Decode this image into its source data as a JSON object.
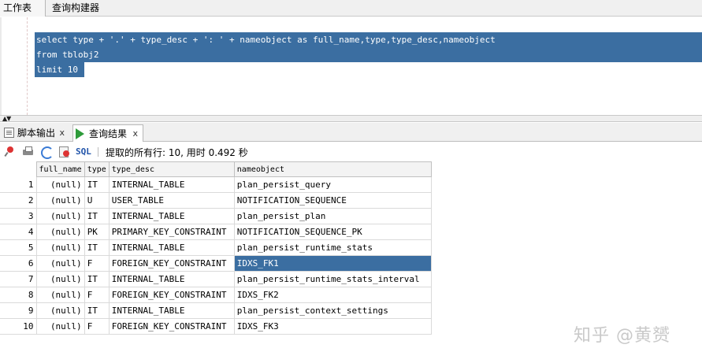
{
  "top_tabs": [
    "工作表",
    "查询构建器"
  ],
  "editor": {
    "lines": [
      "select type + '.' + type_desc + ': ' + nameobject as full_name,type,type_desc,nameobject",
      "from tblobj2",
      "limit 10"
    ]
  },
  "output_tabs": [
    {
      "label": "脚本输出",
      "close": "x"
    },
    {
      "label": "查询结果",
      "close": "x"
    }
  ],
  "toolbar": {
    "icons": [
      "pin-icon",
      "print-icon",
      "refresh-icon",
      "export-icon"
    ],
    "sql_label": "SQL",
    "status": "提取的所有行: 10, 用时 0.492 秒"
  },
  "grid": {
    "columns": [
      "full_name",
      "type",
      "type_desc",
      "nameobject"
    ],
    "rows": [
      {
        "n": "1",
        "full_name": "(null)",
        "type": "IT",
        "type_desc": "INTERNAL_TABLE",
        "nameobject": "plan_persist_query"
      },
      {
        "n": "2",
        "full_name": "(null)",
        "type": "U",
        "type_desc": "USER_TABLE",
        "nameobject": "NOTIFICATION_SEQUENCE"
      },
      {
        "n": "3",
        "full_name": "(null)",
        "type": "IT",
        "type_desc": "INTERNAL_TABLE",
        "nameobject": "plan_persist_plan"
      },
      {
        "n": "4",
        "full_name": "(null)",
        "type": "PK",
        "type_desc": "PRIMARY_KEY_CONSTRAINT",
        "nameobject": "NOTIFICATION_SEQUENCE_PK"
      },
      {
        "n": "5",
        "full_name": "(null)",
        "type": "IT",
        "type_desc": "INTERNAL_TABLE",
        "nameobject": "plan_persist_runtime_stats"
      },
      {
        "n": "6",
        "full_name": "(null)",
        "type": "F",
        "type_desc": "FOREIGN_KEY_CONSTRAINT",
        "nameobject": "IDXS_FK1"
      },
      {
        "n": "7",
        "full_name": "(null)",
        "type": "IT",
        "type_desc": "INTERNAL_TABLE",
        "nameobject": "plan_persist_runtime_stats_interval"
      },
      {
        "n": "8",
        "full_name": "(null)",
        "type": "F",
        "type_desc": "FOREIGN_KEY_CONSTRAINT",
        "nameobject": "IDXS_FK2"
      },
      {
        "n": "9",
        "full_name": "(null)",
        "type": "IT",
        "type_desc": "INTERNAL_TABLE",
        "nameobject": "plan_persist_context_settings"
      },
      {
        "n": "10",
        "full_name": "(null)",
        "type": "F",
        "type_desc": "FOREIGN_KEY_CONSTRAINT",
        "nameobject": "IDXS_FK3"
      }
    ],
    "selected_row": 6
  },
  "watermark": "知乎 @黄赟",
  "colors": {
    "selection": "#3b6ea1",
    "run_icon": "#2e9b3a"
  }
}
